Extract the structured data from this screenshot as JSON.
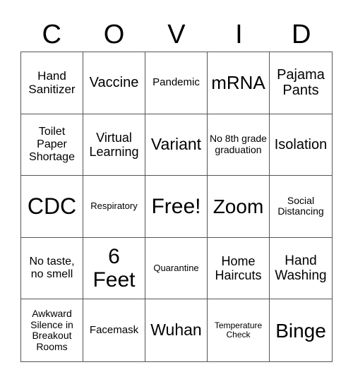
{
  "title_letters": [
    "C",
    "O",
    "V",
    "I",
    "D"
  ],
  "cells": [
    {
      "text": "Hand Sanitizer",
      "size": 17
    },
    {
      "text": "Vaccine",
      "size": 20
    },
    {
      "text": "Pandemic",
      "size": 15
    },
    {
      "text": "mRNA",
      "size": 26
    },
    {
      "text": "Pajama Pants",
      "size": 20
    },
    {
      "text": "Toilet Paper Shortage",
      "size": 16
    },
    {
      "text": "Virtual Learning",
      "size": 18
    },
    {
      "text": "Variant",
      "size": 23
    },
    {
      "text": "No 8th grade graduation",
      "size": 14
    },
    {
      "text": "Isolation",
      "size": 20
    },
    {
      "text": "CDC",
      "size": 32
    },
    {
      "text": "Respiratory",
      "size": 13
    },
    {
      "text": "Free!",
      "size": 30
    },
    {
      "text": "Zoom",
      "size": 28
    },
    {
      "text": "Social Distancing",
      "size": 14
    },
    {
      "text": "No taste, no smell",
      "size": 16
    },
    {
      "text": "6 Feet",
      "size": 30
    },
    {
      "text": "Quarantine",
      "size": 13
    },
    {
      "text": "Home Haircuts",
      "size": 18
    },
    {
      "text": "Hand Washing",
      "size": 19
    },
    {
      "text": "Awkward Silence in Breakout Rooms",
      "size": 14
    },
    {
      "text": "Facemask",
      "size": 15
    },
    {
      "text": "Wuhan",
      "size": 23
    },
    {
      "text": "Temperature Check",
      "size": 12
    },
    {
      "text": "Binge",
      "size": 28
    }
  ]
}
